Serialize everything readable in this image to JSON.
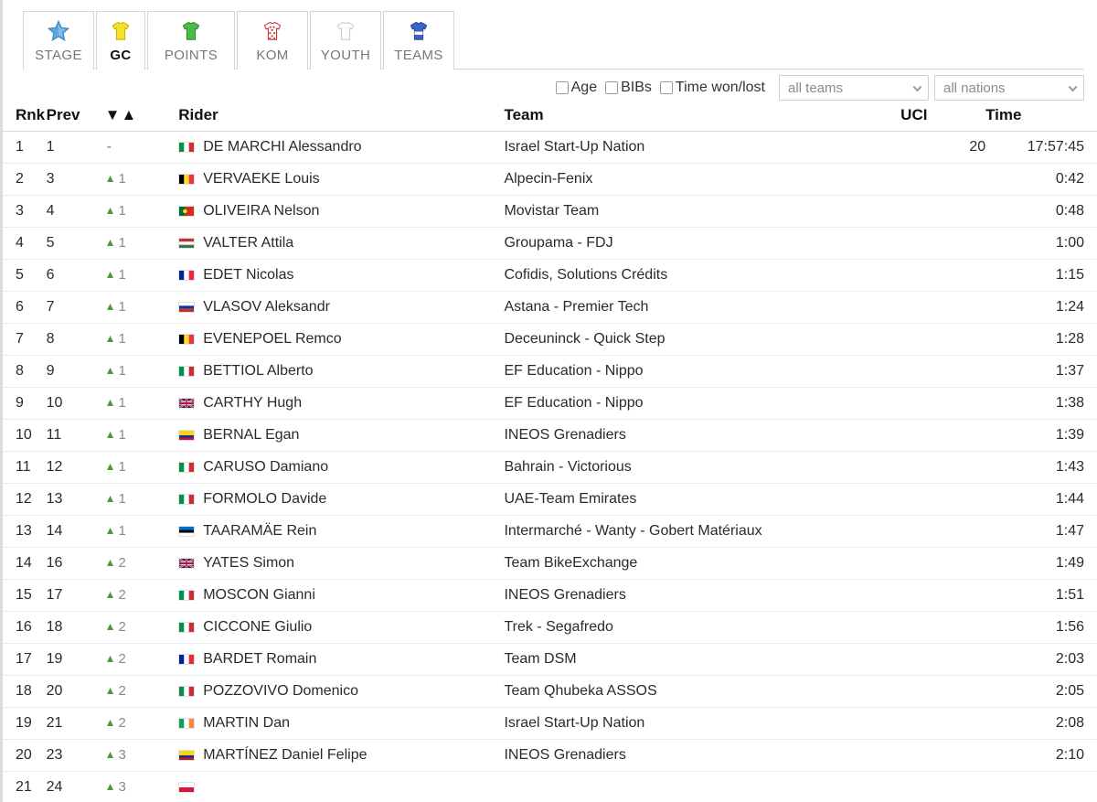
{
  "tabs": [
    {
      "id": "stage",
      "label": "STAGE",
      "icon": "star-jersey-icon",
      "active": false
    },
    {
      "id": "gc",
      "label": "GC",
      "icon": "yellow-jersey-icon",
      "active": true
    },
    {
      "id": "points",
      "label": "POINTS",
      "icon": "green-jersey-icon",
      "active": false
    },
    {
      "id": "kom",
      "label": "KOM",
      "icon": "polkadot-jersey-icon",
      "active": false
    },
    {
      "id": "youth",
      "label": "YOUTH",
      "icon": "white-jersey-icon",
      "active": false
    },
    {
      "id": "teams",
      "label": "TEAMS",
      "icon": "blue-jersey-icon",
      "active": false
    }
  ],
  "filters": {
    "checkboxes": [
      {
        "id": "age",
        "label": "Age",
        "checked": false
      },
      {
        "id": "bibs",
        "label": "BIBs",
        "checked": false
      },
      {
        "id": "twl",
        "label": "Time won/lost",
        "checked": false
      }
    ],
    "team_select": {
      "value": "all teams",
      "placeholder": "all teams"
    },
    "nation_select": {
      "value": "all nations",
      "placeholder": "all nations"
    }
  },
  "table": {
    "headers": {
      "rnk": "Rnk",
      "prev": "Prev",
      "sort": "▼▲",
      "rider": "Rider",
      "team": "Team",
      "uci": "UCI",
      "time": "Time"
    },
    "rows": [
      {
        "rnk": "1",
        "prev": "1",
        "delta": "-",
        "delta_dir": "none",
        "flag": "it",
        "rider": "DE MARCHI Alessandro",
        "team": "Israel Start-Up Nation",
        "uci": "20",
        "time": "17:57:45"
      },
      {
        "rnk": "2",
        "prev": "3",
        "delta": "1",
        "delta_dir": "up",
        "flag": "be",
        "rider": "VERVAEKE Louis",
        "team": "Alpecin-Fenix",
        "uci": "",
        "time": "0:42"
      },
      {
        "rnk": "3",
        "prev": "4",
        "delta": "1",
        "delta_dir": "up",
        "flag": "pt",
        "rider": "OLIVEIRA Nelson",
        "team": "Movistar Team",
        "uci": "",
        "time": "0:48"
      },
      {
        "rnk": "4",
        "prev": "5",
        "delta": "1",
        "delta_dir": "up",
        "flag": "hu",
        "rider": "VALTER Attila",
        "team": "Groupama - FDJ",
        "uci": "",
        "time": "1:00"
      },
      {
        "rnk": "5",
        "prev": "6",
        "delta": "1",
        "delta_dir": "up",
        "flag": "fr",
        "rider": "EDET Nicolas",
        "team": "Cofidis, Solutions Crédits",
        "uci": "",
        "time": "1:15"
      },
      {
        "rnk": "6",
        "prev": "7",
        "delta": "1",
        "delta_dir": "up",
        "flag": "ru",
        "rider": "VLASOV Aleksandr",
        "team": "Astana - Premier Tech",
        "uci": "",
        "time": "1:24"
      },
      {
        "rnk": "7",
        "prev": "8",
        "delta": "1",
        "delta_dir": "up",
        "flag": "be",
        "rider": "EVENEPOEL Remco",
        "team": "Deceuninck - Quick Step",
        "uci": "",
        "time": "1:28"
      },
      {
        "rnk": "8",
        "prev": "9",
        "delta": "1",
        "delta_dir": "up",
        "flag": "it",
        "rider": "BETTIOL Alberto",
        "team": "EF Education - Nippo",
        "uci": "",
        "time": "1:37"
      },
      {
        "rnk": "9",
        "prev": "10",
        "delta": "1",
        "delta_dir": "up",
        "flag": "gb",
        "rider": "CARTHY Hugh",
        "team": "EF Education - Nippo",
        "uci": "",
        "time": "1:38"
      },
      {
        "rnk": "10",
        "prev": "11",
        "delta": "1",
        "delta_dir": "up",
        "flag": "co",
        "rider": "BERNAL Egan",
        "team": "INEOS Grenadiers",
        "uci": "",
        "time": "1:39"
      },
      {
        "rnk": "11",
        "prev": "12",
        "delta": "1",
        "delta_dir": "up",
        "flag": "it",
        "rider": "CARUSO Damiano",
        "team": "Bahrain - Victorious",
        "uci": "",
        "time": "1:43"
      },
      {
        "rnk": "12",
        "prev": "13",
        "delta": "1",
        "delta_dir": "up",
        "flag": "it",
        "rider": "FORMOLO Davide",
        "team": "UAE-Team Emirates",
        "uci": "",
        "time": "1:44"
      },
      {
        "rnk": "13",
        "prev": "14",
        "delta": "1",
        "delta_dir": "up",
        "flag": "ee",
        "rider": "TAARAMÄE Rein",
        "team": "Intermarché - Wanty - Gobert Matériaux",
        "uci": "",
        "time": "1:47"
      },
      {
        "rnk": "14",
        "prev": "16",
        "delta": "2",
        "delta_dir": "up",
        "flag": "gb",
        "rider": "YATES Simon",
        "team": "Team BikeExchange",
        "uci": "",
        "time": "1:49"
      },
      {
        "rnk": "15",
        "prev": "17",
        "delta": "2",
        "delta_dir": "up",
        "flag": "it",
        "rider": "MOSCON Gianni",
        "team": "INEOS Grenadiers",
        "uci": "",
        "time": "1:51"
      },
      {
        "rnk": "16",
        "prev": "18",
        "delta": "2",
        "delta_dir": "up",
        "flag": "it",
        "rider": "CICCONE Giulio",
        "team": "Trek - Segafredo",
        "uci": "",
        "time": "1:56"
      },
      {
        "rnk": "17",
        "prev": "19",
        "delta": "2",
        "delta_dir": "up",
        "flag": "fr",
        "rider": "BARDET Romain",
        "team": "Team DSM",
        "uci": "",
        "time": "2:03"
      },
      {
        "rnk": "18",
        "prev": "20",
        "delta": "2",
        "delta_dir": "up",
        "flag": "it",
        "rider": "POZZOVIVO Domenico",
        "team": "Team Qhubeka ASSOS",
        "uci": "",
        "time": "2:05"
      },
      {
        "rnk": "19",
        "prev": "21",
        "delta": "2",
        "delta_dir": "up",
        "flag": "ie",
        "rider": "MARTIN Dan",
        "team": "Israel Start-Up Nation",
        "uci": "",
        "time": "2:08"
      },
      {
        "rnk": "20",
        "prev": "23",
        "delta": "3",
        "delta_dir": "up",
        "flag": "co",
        "rider": "MARTÍNEZ Daniel Felipe",
        "team": "INEOS Grenadiers",
        "uci": "",
        "time": "2:10"
      },
      {
        "rnk": "21",
        "prev": "24",
        "delta": "3",
        "delta_dir": "up",
        "flag": "pl",
        "rider": "",
        "team": "",
        "uci": "",
        "time": ""
      }
    ]
  }
}
